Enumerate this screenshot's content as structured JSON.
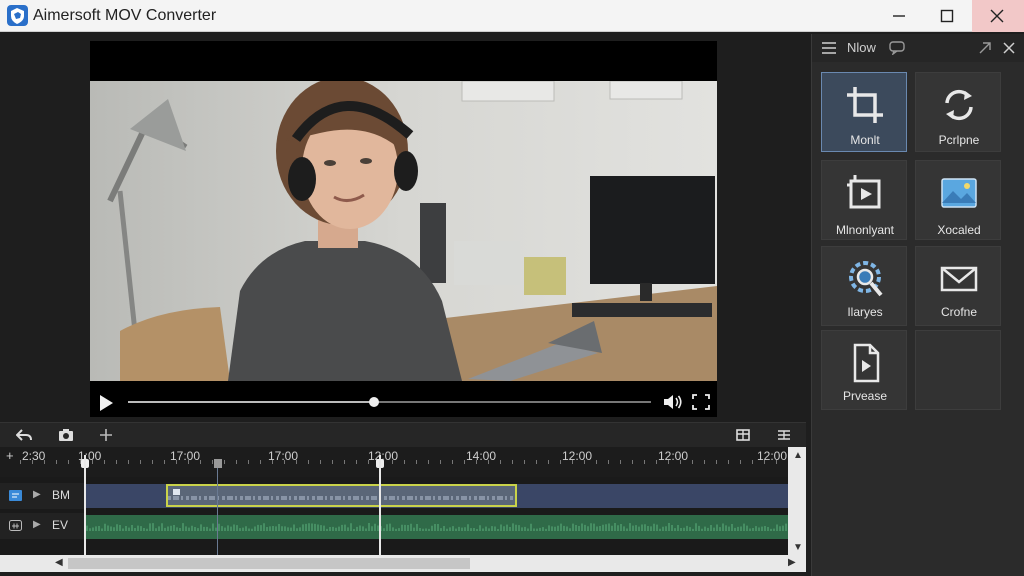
{
  "window": {
    "title": "Aimersoft MOV Converter"
  },
  "player": {
    "progress": 0.47
  },
  "panel": {
    "title": "Nlow",
    "tiles": [
      {
        "label": "Monlt",
        "icon": "crop-icon",
        "active": true
      },
      {
        "label": "Pcrlpne",
        "icon": "rotate-icon",
        "active": false
      },
      {
        "label": "Mlnonlyant",
        "icon": "frame-icon",
        "active": false
      },
      {
        "label": "Xocaled",
        "icon": "image-icon",
        "active": false
      },
      {
        "label": "Ilaryes",
        "icon": "settings-search-icon",
        "active": false
      },
      {
        "label": "Crofne",
        "icon": "envelope-icon",
        "active": false
      },
      {
        "label": "Prvease",
        "icon": "document-icon",
        "active": false
      }
    ]
  },
  "timeline": {
    "ruler_labels": [
      "2:30",
      "1:00",
      "17:00",
      "17:00",
      "12:00",
      "14:00",
      "12:00",
      "12:00",
      "12:00"
    ],
    "tracks": [
      {
        "name": "BM",
        "icon": "video-track-icon"
      },
      {
        "name": "EV",
        "icon": "audio-track-icon"
      }
    ]
  },
  "colors": {
    "accent": "#6a89b0",
    "clip_border": "#c9d24a",
    "video_lane": "#3a4666",
    "audio_lane": "#2f6a48"
  }
}
